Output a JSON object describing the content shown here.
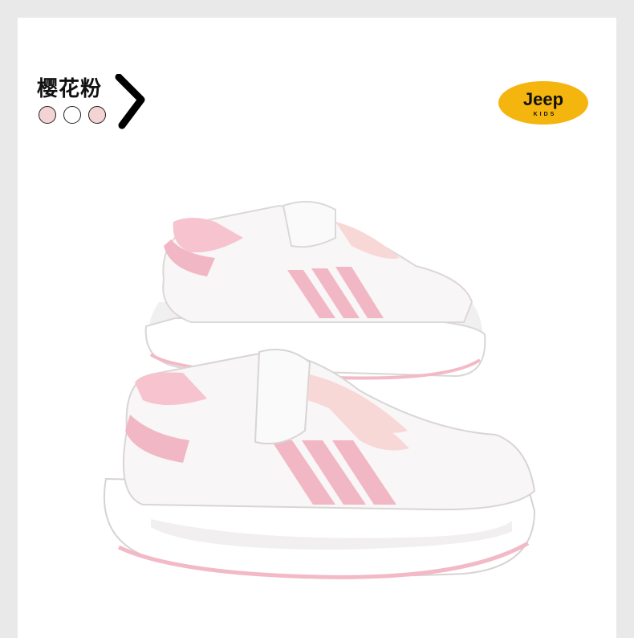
{
  "color_label": "樱花粉",
  "swatches": [
    {
      "name": "pink",
      "color": "#f3d3d3"
    },
    {
      "name": "white",
      "color": "#ffffff"
    },
    {
      "name": "pink",
      "color": "#f3d3d3"
    }
  ],
  "brand": {
    "name": "Jeep",
    "sub": "KIDS",
    "badge_color": "#f5b50f"
  },
  "colors": {
    "accent_pink": "#f2c1cc",
    "shoe_white": "#f8f6f6",
    "sole_pink": "#f3b9c6",
    "background": "#e9e9e9"
  }
}
